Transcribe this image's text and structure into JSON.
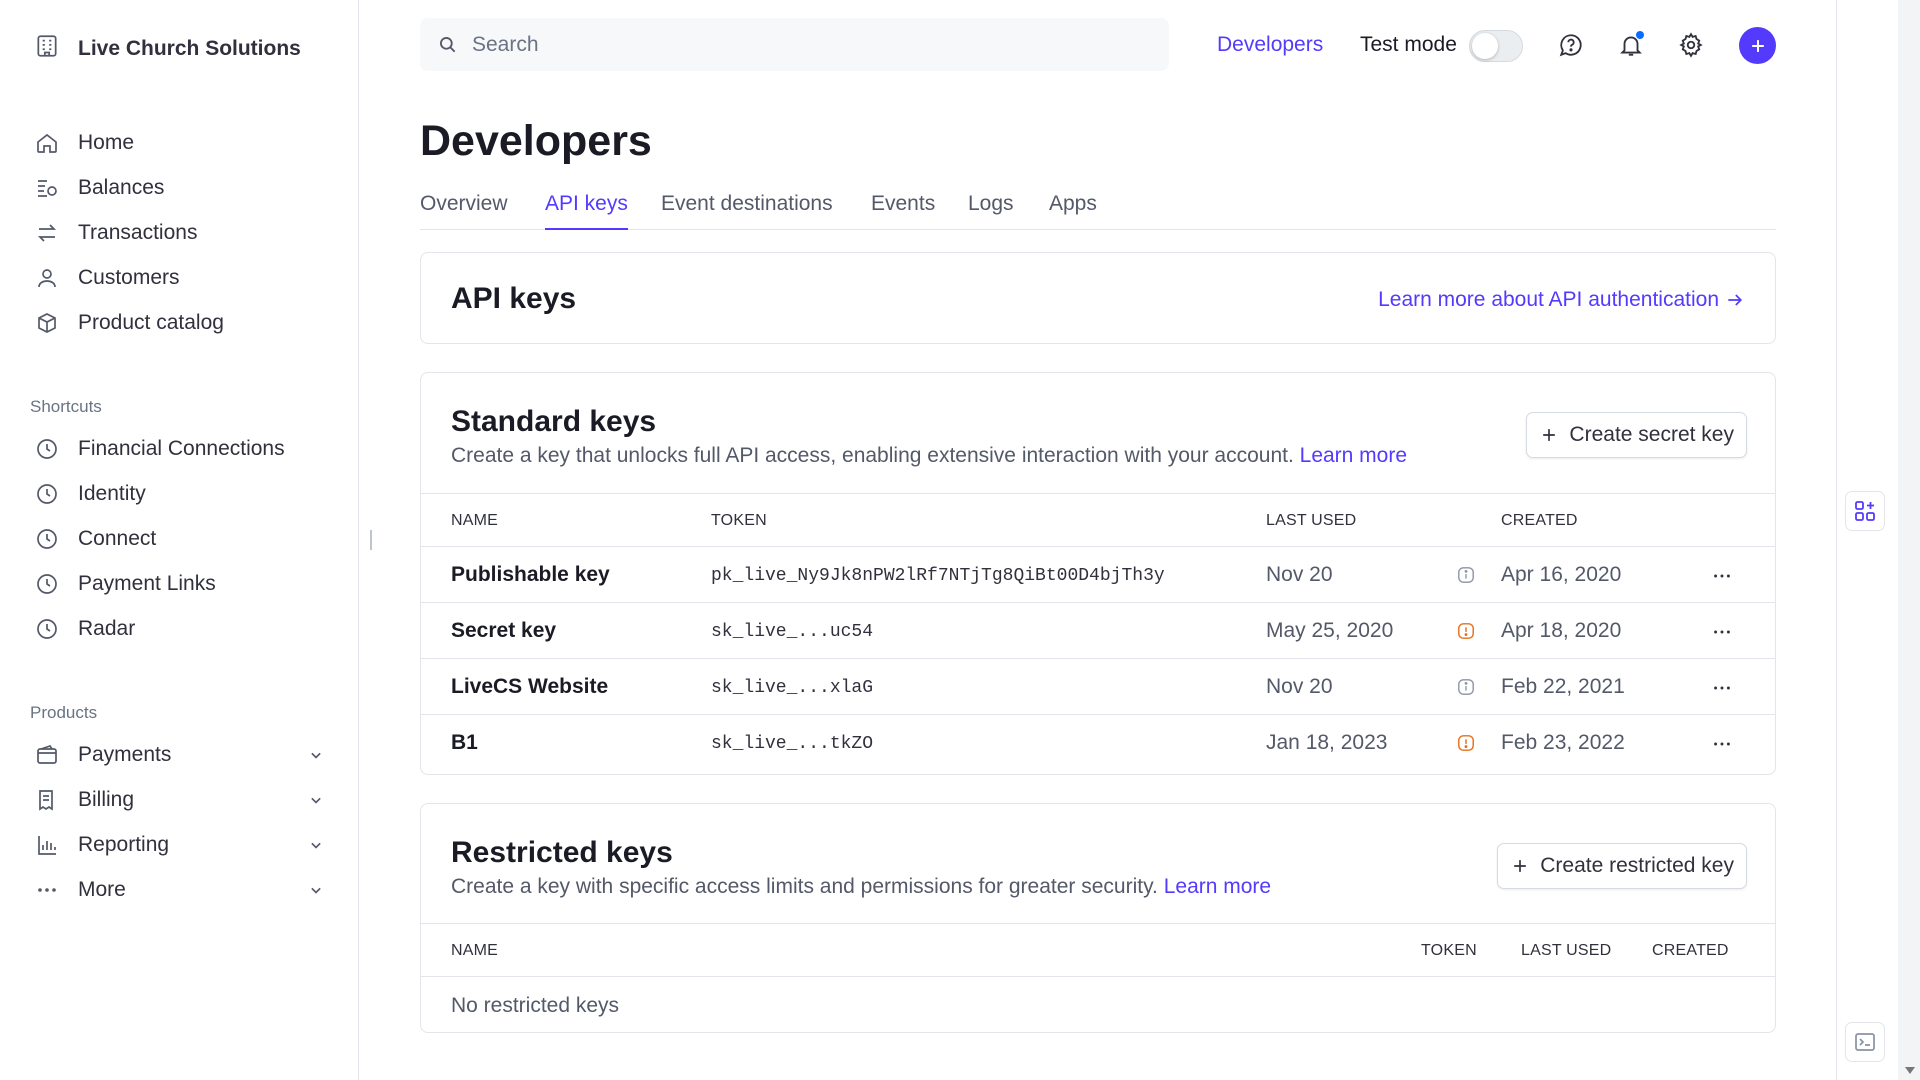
{
  "account": {
    "name": "Live Church Solutions",
    "icon": "building-icon"
  },
  "sidebar": {
    "main": [
      {
        "label": "Home",
        "icon": "home-icon"
      },
      {
        "label": "Balances",
        "icon": "balances-icon"
      },
      {
        "label": "Transactions",
        "icon": "arrows-icon"
      },
      {
        "label": "Customers",
        "icon": "person-icon"
      },
      {
        "label": "Product catalog",
        "icon": "box-icon"
      }
    ],
    "shortcuts_label": "Shortcuts",
    "shortcuts": [
      {
        "label": "Financial Connections",
        "icon": "clock-icon"
      },
      {
        "label": "Identity",
        "icon": "clock-icon"
      },
      {
        "label": "Connect",
        "icon": "clock-icon"
      },
      {
        "label": "Payment Links",
        "icon": "clock-icon"
      },
      {
        "label": "Radar",
        "icon": "clock-icon"
      }
    ],
    "products_label": "Products",
    "products": [
      {
        "label": "Payments",
        "icon": "wallet-icon"
      },
      {
        "label": "Billing",
        "icon": "receipt-icon"
      },
      {
        "label": "Reporting",
        "icon": "bar-chart-icon"
      },
      {
        "label": "More",
        "icon": "ellipsis-icon"
      }
    ]
  },
  "topbar": {
    "search_placeholder": "Search",
    "developers_link": "Developers",
    "test_mode_label": "Test mode"
  },
  "page": {
    "title": "Developers",
    "tabs": [
      "Overview",
      "API keys",
      "Event destinations",
      "Events",
      "Logs",
      "Apps"
    ],
    "active_tab": "API keys"
  },
  "api_keys_card": {
    "title": "API keys",
    "link": "Learn more about API authentication"
  },
  "standard_keys": {
    "title": "Standard keys",
    "description": "Create a key that unlocks full API access, enabling extensive interaction with your account.",
    "learn_more": "Learn more",
    "button": "Create secret key",
    "columns": {
      "name": "NAME",
      "token": "TOKEN",
      "last_used": "LAST USED",
      "created": "CREATED"
    },
    "rows": [
      {
        "name": "Publishable key",
        "token": "pk_live_Ny9Jk8nPW2lRf7NTjTg8QiBt00D4bjTh3y",
        "last_used": "Nov 20",
        "created": "Apr 16, 2020",
        "info_color": "#8792a2"
      },
      {
        "name": "Secret key",
        "token": "sk_live_...uc54",
        "last_used": "May 25, 2020",
        "created": "Apr 18, 2020",
        "info_color": "#e56f1a"
      },
      {
        "name": "LiveCS Website",
        "token": "sk_live_...xlaG",
        "last_used": "Nov 20",
        "created": "Feb 22, 2021",
        "info_color": "#8792a2"
      },
      {
        "name": "B1",
        "token": "sk_live_...tkZO",
        "last_used": "Jan 18, 2023",
        "created": "Feb 23, 2022",
        "info_color": "#e56f1a"
      }
    ]
  },
  "restricted_keys": {
    "title": "Restricted keys",
    "description": "Create a key with specific access limits and permissions for greater security.",
    "learn_more": "Learn more",
    "button": "Create restricted key",
    "columns": {
      "name": "NAME",
      "token": "TOKEN",
      "last_used": "LAST USED",
      "created": "CREATED"
    },
    "empty": "No restricted keys"
  },
  "colors": {
    "accent": "#533afd",
    "warning": "#e56f1a",
    "neutral_icon": "#8792a2"
  }
}
